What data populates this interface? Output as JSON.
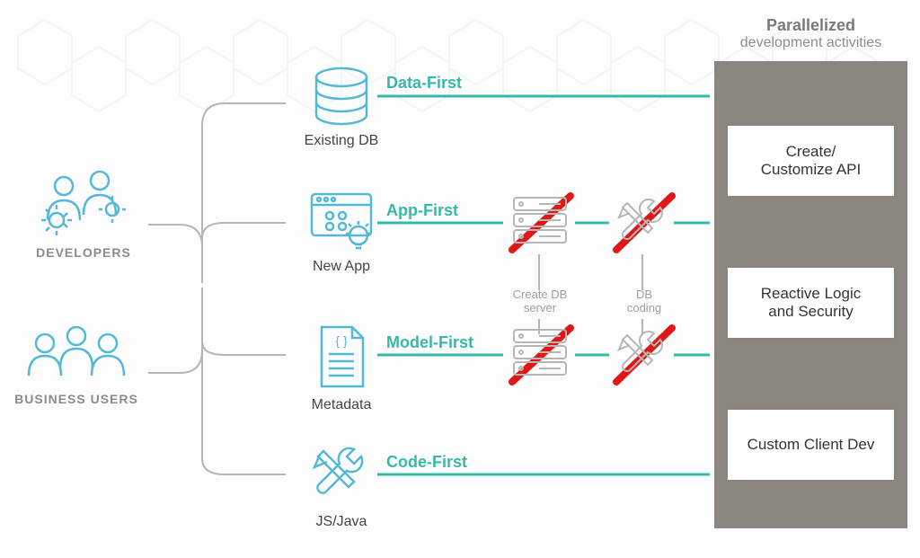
{
  "colors": {
    "teal": "#37b9a8",
    "gray": "#8b8680",
    "iconBlue": "#54b8d6",
    "lightGray": "#b6b6b6"
  },
  "personas": {
    "developers": {
      "label": "DEVELOPERS"
    },
    "business_users": {
      "label": "BUSINESS USERS"
    }
  },
  "approaches": {
    "data_first": {
      "path_label": "Data-First",
      "caption": "Existing DB"
    },
    "app_first": {
      "path_label": "App-First",
      "caption": "New App"
    },
    "model_first": {
      "path_label": "Model-First",
      "caption": "Metadata"
    },
    "code_first": {
      "path_label": "Code-First",
      "caption": "JS/Java"
    }
  },
  "intermediate": {
    "create_db": "Create DB\nserver",
    "db_coding": "DB\ncoding"
  },
  "right": {
    "title_line1": "Parallelized",
    "title_line2": "development activities",
    "cards": {
      "api": "Create/\nCustomize API",
      "logic": "Reactive Logic\nand Security",
      "client": "Custom Client Dev"
    }
  }
}
